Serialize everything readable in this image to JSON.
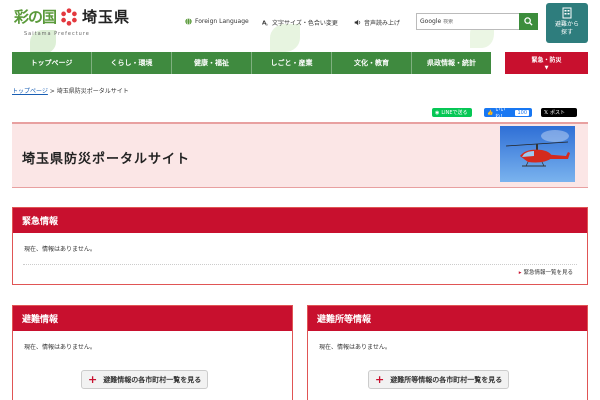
{
  "header": {
    "logo_left": "彩の国",
    "logo_pref": "埼玉県",
    "logo_sub": "Saitama Prefecture",
    "utility": {
      "foreign": "Foreign Language",
      "fontsize": "文字サイズ・色合い変更",
      "voice": "音声読み上げ"
    },
    "search": {
      "label": "Google",
      "placeholder": "検索"
    },
    "evac_button": {
      "line1": "避難から",
      "line2": "探す"
    }
  },
  "nav": {
    "items": [
      "トップページ",
      "くらし・環境",
      "健康・福祉",
      "しごと・産業",
      "文化・教育",
      "県政情報・統計"
    ],
    "emergency": "緊急・防災",
    "emergency_arrow": "▼"
  },
  "breadcrumb": {
    "home": "トップページ",
    "sep": " > ",
    "current": "埼玉県防災ポータルサイト"
  },
  "social": {
    "line": "LINEで送る",
    "like": "いいね！",
    "like_count": "100",
    "post": "ポスト"
  },
  "page_title": "埼玉県防災ポータルサイト",
  "emergency": {
    "heading": "緊急情報",
    "body": "現在、情報はありません。",
    "more": "緊急情報一覧を見る"
  },
  "evacuation": {
    "heading": "避難情報",
    "body": "現在、情報はありません。",
    "button": "避難情報の各市町村一覧を見る"
  },
  "shelter": {
    "heading": "避難所等情報",
    "body": "現在、情報はありません。",
    "button": "避難所等情報の各市町村一覧を見る"
  },
  "colors": {
    "green": "#3f8a3f",
    "red": "#c8102e",
    "teal": "#2e7d7d",
    "pink_bg": "#fbe6e6"
  }
}
